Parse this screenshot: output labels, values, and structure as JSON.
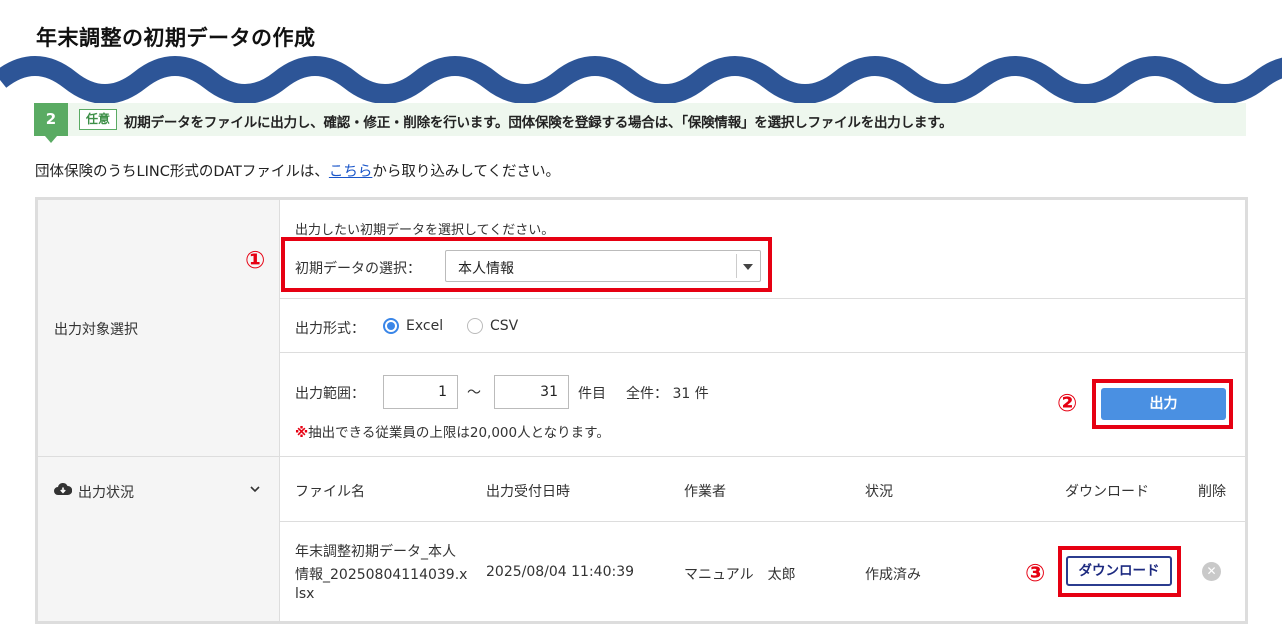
{
  "page_title": "年末調整の初期データの作成",
  "step": {
    "number": "2",
    "badge": "任意",
    "text": "初期データをファイルに出力し、確認・修正・削除を行います。団体保険を登録する場合は、「保険情報」を選択しファイルを出力します。"
  },
  "notice": {
    "before": "団体保険のうちLINC形式のDATファイルは、",
    "link": "こちら",
    "after": "から取り込みしてください。"
  },
  "output_target": {
    "label": "出力対象選択",
    "instruction": "出力したい初期データを選択してください。",
    "select_label": "初期データの選択：",
    "select_value": "本人情報",
    "format_label": "出力形式：",
    "format_options": [
      "Excel",
      "CSV"
    ],
    "format_selected": "Excel",
    "range_label": "出力範囲：",
    "range_from": "1",
    "range_sep": "～",
    "range_to": "31",
    "range_unit": "件目",
    "total_text": "全件： 31 件",
    "limit_mark": "※",
    "limit_text": "抽出できる従業員の上限は20,000人となります。",
    "output_button": "出力"
  },
  "output_status": {
    "label": "出力状況",
    "columns": [
      "ファイル名",
      "出力受付日時",
      "作業者",
      "状況",
      "ダウンロード",
      "削除"
    ],
    "rows": [
      {
        "file_name_lines": [
          "年末調整初期データ_本人",
          "情報_20250804114039.x",
          "lsx"
        ],
        "datetime": "2025/08/04 11:40:39",
        "operator": "マニュアル　太郎",
        "status": "作成済み",
        "download_label": "ダウンロード"
      }
    ]
  },
  "callouts": [
    "①",
    "②",
    "③"
  ],
  "colors": {
    "wave": "#2d5597",
    "step_green": "#5aab63",
    "callout_red": "#e60012",
    "output_button": "#4a90e2",
    "link": "#1a56c9"
  }
}
